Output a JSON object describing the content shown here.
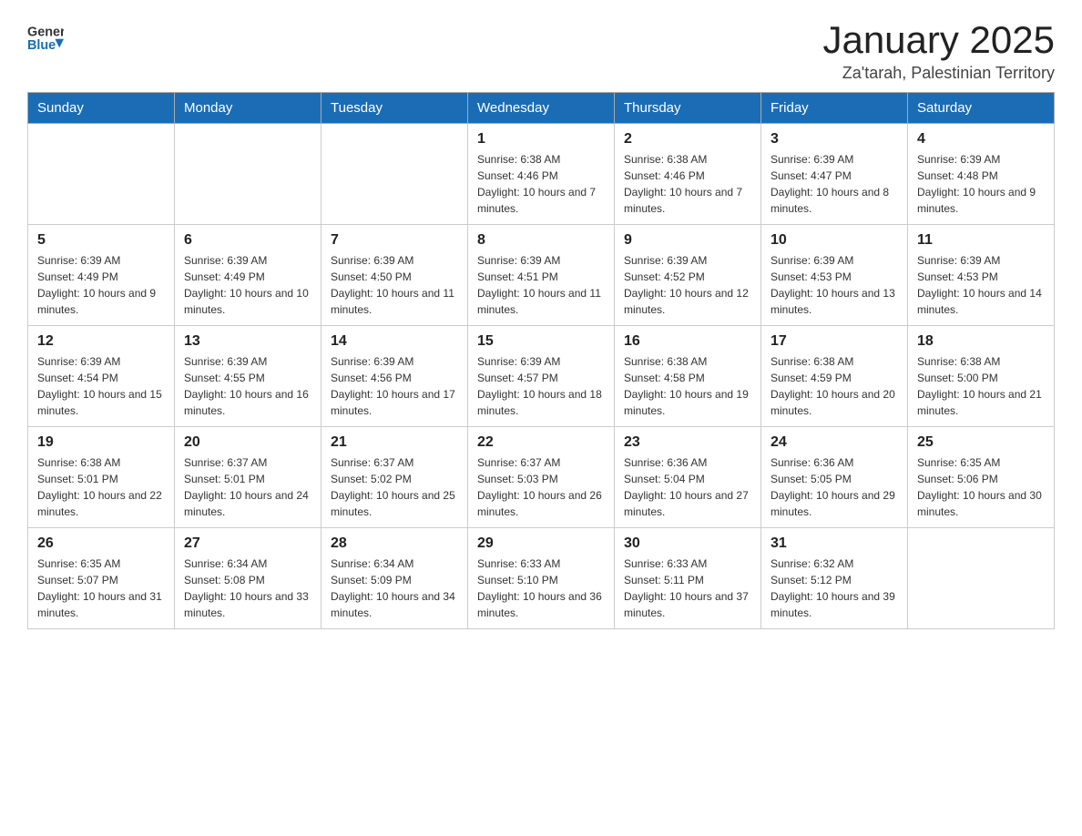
{
  "header": {
    "logo_general": "General",
    "logo_blue": "Blue",
    "month_title": "January 2025",
    "location": "Za'tarah, Palestinian Territory"
  },
  "days_of_week": [
    "Sunday",
    "Monday",
    "Tuesday",
    "Wednesday",
    "Thursday",
    "Friday",
    "Saturday"
  ],
  "weeks": [
    [
      {
        "day": "",
        "info": ""
      },
      {
        "day": "",
        "info": ""
      },
      {
        "day": "",
        "info": ""
      },
      {
        "day": "1",
        "info": "Sunrise: 6:38 AM\nSunset: 4:46 PM\nDaylight: 10 hours and 7 minutes."
      },
      {
        "day": "2",
        "info": "Sunrise: 6:38 AM\nSunset: 4:46 PM\nDaylight: 10 hours and 7 minutes."
      },
      {
        "day": "3",
        "info": "Sunrise: 6:39 AM\nSunset: 4:47 PM\nDaylight: 10 hours and 8 minutes."
      },
      {
        "day": "4",
        "info": "Sunrise: 6:39 AM\nSunset: 4:48 PM\nDaylight: 10 hours and 9 minutes."
      }
    ],
    [
      {
        "day": "5",
        "info": "Sunrise: 6:39 AM\nSunset: 4:49 PM\nDaylight: 10 hours and 9 minutes."
      },
      {
        "day": "6",
        "info": "Sunrise: 6:39 AM\nSunset: 4:49 PM\nDaylight: 10 hours and 10 minutes."
      },
      {
        "day": "7",
        "info": "Sunrise: 6:39 AM\nSunset: 4:50 PM\nDaylight: 10 hours and 11 minutes."
      },
      {
        "day": "8",
        "info": "Sunrise: 6:39 AM\nSunset: 4:51 PM\nDaylight: 10 hours and 11 minutes."
      },
      {
        "day": "9",
        "info": "Sunrise: 6:39 AM\nSunset: 4:52 PM\nDaylight: 10 hours and 12 minutes."
      },
      {
        "day": "10",
        "info": "Sunrise: 6:39 AM\nSunset: 4:53 PM\nDaylight: 10 hours and 13 minutes."
      },
      {
        "day": "11",
        "info": "Sunrise: 6:39 AM\nSunset: 4:53 PM\nDaylight: 10 hours and 14 minutes."
      }
    ],
    [
      {
        "day": "12",
        "info": "Sunrise: 6:39 AM\nSunset: 4:54 PM\nDaylight: 10 hours and 15 minutes."
      },
      {
        "day": "13",
        "info": "Sunrise: 6:39 AM\nSunset: 4:55 PM\nDaylight: 10 hours and 16 minutes."
      },
      {
        "day": "14",
        "info": "Sunrise: 6:39 AM\nSunset: 4:56 PM\nDaylight: 10 hours and 17 minutes."
      },
      {
        "day": "15",
        "info": "Sunrise: 6:39 AM\nSunset: 4:57 PM\nDaylight: 10 hours and 18 minutes."
      },
      {
        "day": "16",
        "info": "Sunrise: 6:38 AM\nSunset: 4:58 PM\nDaylight: 10 hours and 19 minutes."
      },
      {
        "day": "17",
        "info": "Sunrise: 6:38 AM\nSunset: 4:59 PM\nDaylight: 10 hours and 20 minutes."
      },
      {
        "day": "18",
        "info": "Sunrise: 6:38 AM\nSunset: 5:00 PM\nDaylight: 10 hours and 21 minutes."
      }
    ],
    [
      {
        "day": "19",
        "info": "Sunrise: 6:38 AM\nSunset: 5:01 PM\nDaylight: 10 hours and 22 minutes."
      },
      {
        "day": "20",
        "info": "Sunrise: 6:37 AM\nSunset: 5:01 PM\nDaylight: 10 hours and 24 minutes."
      },
      {
        "day": "21",
        "info": "Sunrise: 6:37 AM\nSunset: 5:02 PM\nDaylight: 10 hours and 25 minutes."
      },
      {
        "day": "22",
        "info": "Sunrise: 6:37 AM\nSunset: 5:03 PM\nDaylight: 10 hours and 26 minutes."
      },
      {
        "day": "23",
        "info": "Sunrise: 6:36 AM\nSunset: 5:04 PM\nDaylight: 10 hours and 27 minutes."
      },
      {
        "day": "24",
        "info": "Sunrise: 6:36 AM\nSunset: 5:05 PM\nDaylight: 10 hours and 29 minutes."
      },
      {
        "day": "25",
        "info": "Sunrise: 6:35 AM\nSunset: 5:06 PM\nDaylight: 10 hours and 30 minutes."
      }
    ],
    [
      {
        "day": "26",
        "info": "Sunrise: 6:35 AM\nSunset: 5:07 PM\nDaylight: 10 hours and 31 minutes."
      },
      {
        "day": "27",
        "info": "Sunrise: 6:34 AM\nSunset: 5:08 PM\nDaylight: 10 hours and 33 minutes."
      },
      {
        "day": "28",
        "info": "Sunrise: 6:34 AM\nSunset: 5:09 PM\nDaylight: 10 hours and 34 minutes."
      },
      {
        "day": "29",
        "info": "Sunrise: 6:33 AM\nSunset: 5:10 PM\nDaylight: 10 hours and 36 minutes."
      },
      {
        "day": "30",
        "info": "Sunrise: 6:33 AM\nSunset: 5:11 PM\nDaylight: 10 hours and 37 minutes."
      },
      {
        "day": "31",
        "info": "Sunrise: 6:32 AM\nSunset: 5:12 PM\nDaylight: 10 hours and 39 minutes."
      },
      {
        "day": "",
        "info": ""
      }
    ]
  ]
}
